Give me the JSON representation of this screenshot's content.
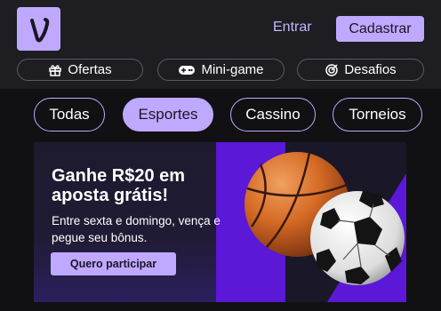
{
  "header": {
    "logo_letter": "V",
    "login_label": "Entrar",
    "signup_label": "Cadastrar"
  },
  "quick_links": [
    {
      "label": "Ofertas",
      "icon": "gift-icon"
    },
    {
      "label": "Mini-game",
      "icon": "gamepad-icon"
    },
    {
      "label": "Desafios",
      "icon": "target-icon"
    }
  ],
  "categories": [
    {
      "label": "Todas",
      "active": false
    },
    {
      "label": "Esportes",
      "active": true
    },
    {
      "label": "Cassino",
      "active": false
    },
    {
      "label": "Torneios",
      "active": false
    }
  ],
  "banner": {
    "title": "Ganhe R$20 em aposta grátis!",
    "subtitle": "Entre sexta e domingo, vença e pegue seu bônus.",
    "cta_label": "Quero participar"
  },
  "colors": {
    "accent": "#bfa9ff",
    "header_bg": "#1e1d22",
    "page_bg": "#111013",
    "banner_purple": "#5b18d6"
  }
}
